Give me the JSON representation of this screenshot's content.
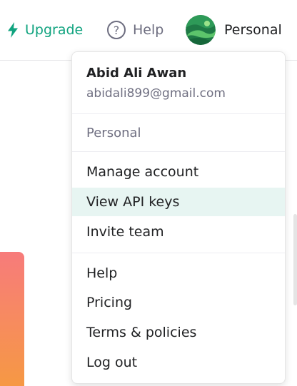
{
  "header": {
    "upgrade_label": "Upgrade",
    "help_label": "Help",
    "account_label": "Personal",
    "icons": {
      "upgrade": "lightning-bolt-icon",
      "help": "question-circle-icon"
    },
    "colors": {
      "accent": "#10a37f",
      "muted": "#6e6e80",
      "text": "#202123"
    }
  },
  "menu": {
    "user_name": "Abid Ali Awan",
    "user_email": "abidali899@gmail.com",
    "organization": "Personal",
    "account_items": [
      {
        "label": "Manage account"
      },
      {
        "label": "View API keys",
        "active": true
      },
      {
        "label": "Invite team"
      }
    ],
    "help_items": [
      {
        "label": "Help"
      },
      {
        "label": "Pricing"
      },
      {
        "label": "Terms & policies"
      },
      {
        "label": "Log out"
      }
    ],
    "hover_color": "#e7f5f2"
  }
}
